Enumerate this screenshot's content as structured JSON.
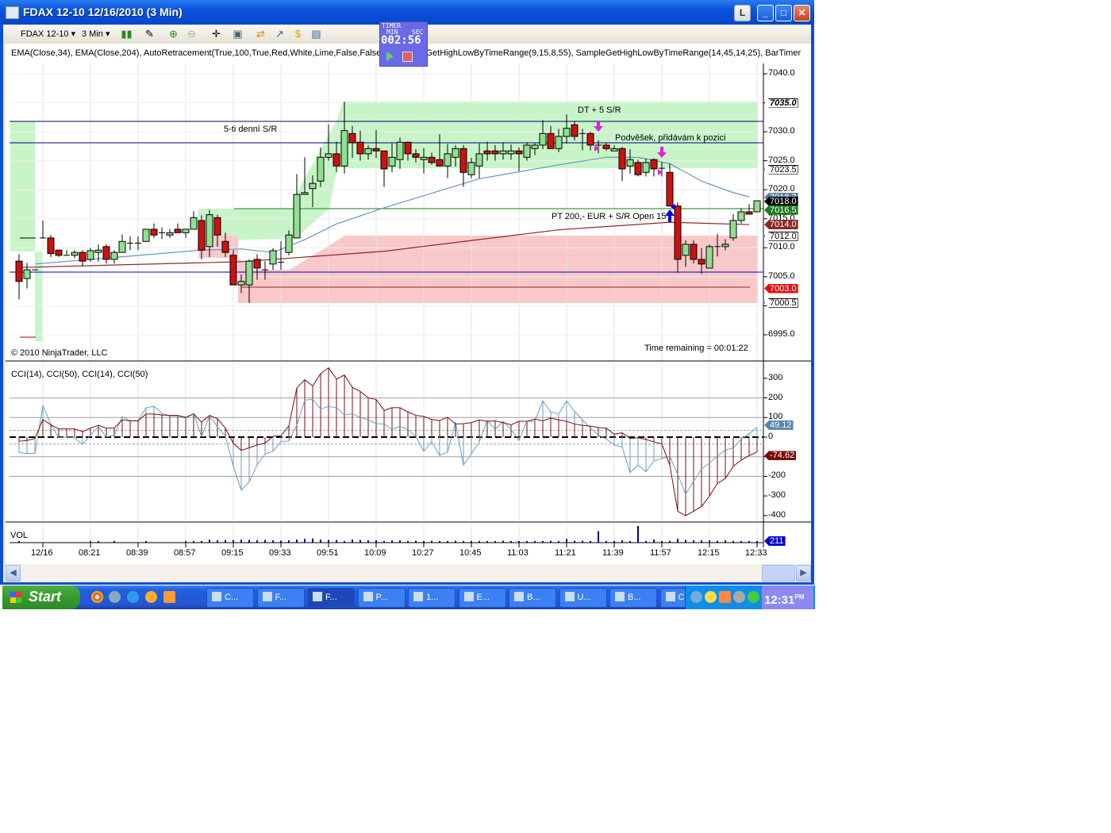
{
  "window": {
    "title": "FDAX 12-10  12/16/2010 (3 Min)",
    "btn_l": "L",
    "btn_min": "_",
    "btn_max": "□",
    "btn_close": "✕"
  },
  "toolbar": {
    "instrument": "FDAX 12-10 ▾",
    "interval": "3 Min ▾"
  },
  "timer": {
    "title": "TIMER",
    "min_label": "MIN",
    "sec_label": "SEC",
    "value": "002:56"
  },
  "indicator_label": "EMA(Close,34),  EMA(Close,204),  AutoRetracement(True,100,True,Red,White,Lime,False,False,5),  SampleGetHighLowByTimeRange(9,15,8,55),  SampleGetHighLowByTimeRange(14,45,14,25),  BarTimer",
  "annotations": {
    "sr5": "5-ti denní S/R",
    "dt": "DT + 5 S/R",
    "podvesek": "Podvěšek, přidávám k pozici",
    "pt": "PT 200,- EUR + S/R Open 15"
  },
  "copyright": "© 2010 NinjaTrader, LLC",
  "time_remaining": "Time remaining = 00:01:22",
  "cci_label": "CCI(14), CCI(50), CCI(14), CCI(50)",
  "vol_label": "VOL",
  "taskbar": {
    "start": "Start",
    "tasks": [
      "C...",
      "F...",
      "F...",
      "P...",
      "1...",
      "E...",
      "B...",
      "U...",
      "B...",
      "CS"
    ],
    "clock": "12:31",
    "clock_ampm": "PM"
  },
  "chart_data": {
    "type": "candlestick",
    "title": "FDAX 12-10 12/16/2010 (3 Min)",
    "price_axis": {
      "ylim": [
        6993,
        7042
      ],
      "ticks": [
        "7040.0",
        "7035.0",
        "7030.0",
        "7025.0",
        "7020.0",
        "7015.0",
        "7010.0",
        "7005.0",
        "7000.0",
        "6995.0"
      ]
    },
    "price_tags": [
      {
        "value": 7035.0,
        "label": "7035.0",
        "bg": "#ffffff",
        "fg": "#000000"
      },
      {
        "value": 7023.5,
        "label": "7023.5",
        "bg": "#ffffff",
        "fg": "#000000"
      },
      {
        "value": 7018.7,
        "label": "7018.7",
        "bg": "#5a7fa0",
        "fg": "#ffffff"
      },
      {
        "value": 7018.0,
        "label": "7018.0",
        "bg": "#000000",
        "fg": "#ffffff"
      },
      {
        "value": 7016.5,
        "label": "7016.5",
        "bg": "#1e7a1e",
        "fg": "#ffffff"
      },
      {
        "value": 7014.0,
        "label": "7014.0",
        "bg": "#8b2a2a",
        "fg": "#ffffff"
      },
      {
        "value": 7012.0,
        "label": "7012.0",
        "bg": "#ffffff",
        "fg": "#000000"
      },
      {
        "value": 7003.0,
        "label": "7003.0",
        "bg": "#e01010",
        "fg": "#ffffff"
      },
      {
        "value": 7000.5,
        "label": "7000.5",
        "bg": "#ffffff",
        "fg": "#000000"
      }
    ],
    "x_ticks": [
      {
        "label": "12/16",
        "bar": 3
      },
      {
        "label": "08:21",
        "bar": 9
      },
      {
        "label": "08:39",
        "bar": 15
      },
      {
        "label": "08:57",
        "bar": 21
      },
      {
        "label": "09:15",
        "bar": 27
      },
      {
        "label": "09:33",
        "bar": 33
      },
      {
        "label": "09:51",
        "bar": 39
      },
      {
        "label": "10:09",
        "bar": 45
      },
      {
        "label": "10:27",
        "bar": 51
      },
      {
        "label": "10:45",
        "bar": 57
      },
      {
        "label": "11:03",
        "bar": 63
      },
      {
        "label": "11:21",
        "bar": 69
      },
      {
        "label": "11:39",
        "bar": 75
      },
      {
        "label": "11:57",
        "bar": 81
      },
      {
        "label": "12:15",
        "bar": 87
      },
      {
        "label": "12:33",
        "bar": 93
      }
    ],
    "ohlc": [
      [
        7007.7,
        7008.9,
        7001.1,
        7004.2
      ],
      [
        7004.7,
        7007.4,
        7003.0,
        7006.2
      ],
      [
        7006.2,
        7006.3,
        7006.1,
        7006.2
      ],
      [
        7011.7,
        7014.7,
        7011.6,
        7011.7
      ],
      [
        7011.7,
        7012.2,
        7008.4,
        7009.0
      ],
      [
        7009.6,
        7009.6,
        7008.4,
        7008.7
      ],
      [
        7008.7,
        7009.6,
        7008.7,
        7008.7
      ],
      [
        7008.7,
        7009.6,
        7008.2,
        7009.2
      ],
      [
        7009.2,
        7009.6,
        7006.8,
        7007.7
      ],
      [
        7008.0,
        7010.0,
        7007.6,
        7009.5
      ],
      [
        7009.2,
        7010.6,
        7007.6,
        7009.6
      ],
      [
        7010.2,
        7010.6,
        7007.3,
        7008.0
      ],
      [
        7008.0,
        7009.6,
        7007.3,
        7009.2
      ],
      [
        7009.2,
        7012.3,
        7009.2,
        7011.1
      ],
      [
        7010.8,
        7012.0,
        7009.6,
        7010.8
      ],
      [
        7010.8,
        7012.0,
        7009.6,
        7010.8
      ],
      [
        7011.1,
        7013.2,
        7011.1,
        7013.2
      ],
      [
        7013.2,
        7014.2,
        7011.7,
        7012.2
      ],
      [
        7012.6,
        7013.5,
        7011.5,
        7012.6
      ],
      [
        7012.2,
        7013.2,
        7011.7,
        7012.6
      ],
      [
        7013.2,
        7014.2,
        7012.6,
        7012.6
      ],
      [
        7012.6,
        7013.2,
        7011.7,
        7013.2
      ],
      [
        7013.2,
        7016.3,
        7013.2,
        7015.2
      ],
      [
        7014.7,
        7015.6,
        7008.0,
        7009.6
      ],
      [
        7010.2,
        7016.5,
        7008.4,
        7015.7
      ],
      [
        7015.2,
        7015.7,
        7010.2,
        7012.2
      ],
      [
        7011.1,
        7012.6,
        7008.4,
        7009.2
      ],
      [
        7008.7,
        7009.6,
        7003.6,
        7003.6
      ],
      [
        7003.6,
        7005.4,
        7002.2,
        7004.2
      ],
      [
        7003.6,
        7008.0,
        7000.5,
        7007.7
      ],
      [
        7008.0,
        7008.9,
        7004.5,
        7006.5
      ],
      [
        7006.2,
        7007.7,
        7004.5,
        7006.2
      ],
      [
        7007.2,
        7009.9,
        7006.2,
        7009.5
      ],
      [
        7007.5,
        7011.1,
        7006.2,
        7007.5
      ],
      [
        7009.2,
        7013.0,
        7008.7,
        7012.2
      ],
      [
        7011.7,
        7022.7,
        7011.7,
        7019.2
      ],
      [
        7019.2,
        7025.6,
        7019.2,
        7019.5
      ],
      [
        7020.2,
        7022.5,
        7017.0,
        7021.1
      ],
      [
        7021.5,
        7027.3,
        7020.5,
        7025.6
      ],
      [
        7025.6,
        7031.3,
        7025.0,
        7026.2
      ],
      [
        7026.2,
        7028.3,
        7023.0,
        7024.1
      ],
      [
        7024.1,
        7035.2,
        7022.8,
        7030.2
      ],
      [
        7029.7,
        7031.0,
        7025.5,
        7028.1
      ],
      [
        7028.2,
        7030.2,
        7025.0,
        7026.2
      ],
      [
        7026.2,
        7027.7,
        7025.2,
        7027.1
      ],
      [
        7027.1,
        7030.3,
        7025.5,
        7026.7
      ],
      [
        7026.7,
        7026.7,
        7020.5,
        7023.6
      ],
      [
        7024.1,
        7028.0,
        7023.0,
        7025.6
      ],
      [
        7025.2,
        7029.0,
        7023.6,
        7028.2
      ],
      [
        7028.2,
        7028.3,
        7025.0,
        7026.2
      ],
      [
        7026.2,
        7027.0,
        7024.7,
        7025.6
      ],
      [
        7025.2,
        7027.2,
        7022.8,
        7025.6
      ],
      [
        7025.6,
        7026.4,
        7024.3,
        7024.7
      ],
      [
        7025.2,
        7029.6,
        7024.0,
        7024.1
      ],
      [
        7024.1,
        7027.9,
        7022.0,
        7026.2
      ],
      [
        7025.6,
        7027.7,
        7024.0,
        7027.1
      ],
      [
        7027.1,
        7027.7,
        7020.5,
        7023.0
      ],
      [
        7022.6,
        7025.5,
        7022.0,
        7024.7
      ],
      [
        7024.1,
        7028.0,
        7022.0,
        7026.2
      ],
      [
        7026.7,
        7028.3,
        7025.0,
        7026.2
      ],
      [
        7026.7,
        7027.7,
        7025.0,
        7026.2
      ],
      [
        7026.2,
        7028.2,
        7025.2,
        7026.7
      ],
      [
        7026.2,
        7027.8,
        7025.2,
        7026.7
      ],
      [
        7026.7,
        7027.3,
        7023.2,
        7026.2
      ],
      [
        7025.6,
        7028.2,
        7025.0,
        7027.7
      ],
      [
        7027.1,
        7028.0,
        7026.0,
        7027.7
      ],
      [
        7027.7,
        7032.0,
        7027.0,
        7029.7
      ],
      [
        7029.7,
        7031.0,
        7027.1,
        7027.1
      ],
      [
        7027.1,
        7030.5,
        7026.5,
        7029.2
      ],
      [
        7029.2,
        7033.0,
        7028.0,
        7030.6
      ],
      [
        7031.2,
        7031.8,
        7028.5,
        7029.2
      ],
      [
        7029.7,
        7030.5,
        7026.8,
        7029.7
      ],
      [
        7029.7,
        7030.0,
        7026.8,
        7027.7
      ],
      [
        7027.7,
        7028.5,
        7026.3,
        7027.7
      ],
      [
        7027.7,
        7028.1,
        7026.7,
        7027.1
      ],
      [
        7026.7,
        7027.7,
        7026.7,
        7027.1
      ],
      [
        7027.1,
        7027.4,
        7021.5,
        7023.6
      ],
      [
        7024.1,
        7027.0,
        7022.8,
        7025.2
      ],
      [
        7024.7,
        7025.2,
        7022.3,
        7022.6
      ],
      [
        7023.0,
        7025.4,
        7022.3,
        7024.7
      ],
      [
        7025.2,
        7025.4,
        7022.3,
        7023.6
      ],
      [
        7023.7,
        7024.8,
        7022.3,
        7023.7
      ],
      [
        7023.0,
        7024.5,
        7017.2,
        7017.2
      ],
      [
        7017.2,
        7017.8,
        7005.7,
        7008.0
      ],
      [
        7008.7,
        7011.3,
        7006.7,
        7010.6
      ],
      [
        7010.6,
        7011.3,
        7007.3,
        7008.0
      ],
      [
        7008.0,
        7010.0,
        7005.5,
        7007.2
      ],
      [
        7006.5,
        7010.6,
        7006.5,
        7010.2
      ],
      [
        7010.2,
        7012.4,
        7008.5,
        7010.2
      ],
      [
        7010.2,
        7011.5,
        7009.6,
        7010.6
      ],
      [
        7011.7,
        7015.8,
        7011.2,
        7014.7
      ],
      [
        7014.7,
        7016.8,
        7014.2,
        7016.2
      ],
      [
        7016.2,
        7017.5,
        7015.8,
        7015.8
      ],
      [
        7016.2,
        7018.1,
        7016.2,
        7018.1
      ]
    ],
    "ema34": {
      "name": "EMA(Close,34)",
      "color": "#6a94bc",
      "points": [
        [
          2,
          7007.2
        ],
        [
          23,
          7009.6
        ],
        [
          28,
          7009.8
        ],
        [
          32,
          7009.2
        ],
        [
          36,
          7011.4
        ],
        [
          40,
          7014.1
        ],
        [
          46,
          7016.9
        ],
        [
          58,
          7021.9
        ],
        [
          68,
          7024.3
        ],
        [
          74,
          7025.6
        ],
        [
          78,
          7025.6
        ],
        [
          82,
          7024.5
        ],
        [
          86,
          7021.5
        ],
        [
          90,
          7019.5
        ],
        [
          92,
          7018.8
        ]
      ]
    },
    "ema204": {
      "name": "EMA(Close,204)",
      "color": "#8b2a2a",
      "points": [
        [
          0,
          7006.6
        ],
        [
          28,
          7007.6
        ],
        [
          46,
          7009.4
        ],
        [
          68,
          7013.1
        ],
        [
          82,
          7014.4
        ],
        [
          92,
          7014.0
        ]
      ]
    },
    "levels": {
      "sr_high_1": 7031.4,
      "sr_high_2": 7027.6,
      "sr_low": 7005.4,
      "pt_line": 7016.75,
      "red_line": 7003.2
    },
    "cci": {
      "axis_ticks": [
        "300",
        "200",
        "100",
        "0",
        "-100",
        "-200",
        "-300",
        "-400"
      ],
      "ylim": [
        -420,
        330
      ],
      "cci14": {
        "name": "CCI(14)",
        "color": "#6a9ec0",
        "last_label": "49.12",
        "values": [
          -79,
          -83,
          -83,
          161,
          67,
          -3,
          1,
          -3,
          -38,
          11,
          53,
          1,
          11,
          104,
          83,
          85,
          150,
          157,
          122,
          108,
          108,
          97,
          119,
          4,
          108,
          53,
          4,
          -149,
          -271,
          -229,
          -142,
          -86,
          -72,
          -24,
          -19,
          60,
          188,
          194,
          143,
          157,
          150,
          113,
          119,
          101,
          88,
          69,
          67,
          39,
          56,
          39,
          4,
          -72,
          -24,
          -93,
          -76,
          76,
          -142,
          -86,
          -24,
          85,
          39,
          81,
          39,
          -17,
          81,
          81,
          185,
          129,
          118,
          185,
          131,
          88,
          46,
          11,
          -10,
          -40,
          -51,
          -181,
          -142,
          -176,
          -121,
          -110,
          -97,
          -190,
          -292,
          -225,
          -163,
          -132,
          -97,
          -65,
          -56,
          -10,
          18,
          49
        ]
      },
      "cci50": {
        "name": "CCI(50)",
        "color": "#7a0c0c",
        "last_label": "-74.62",
        "values": [
          -21,
          -17,
          -7,
          90,
          63,
          42,
          42,
          42,
          28,
          46,
          60,
          46,
          46,
          88,
          83,
          83,
          118,
          118,
          113,
          111,
          111,
          101,
          119,
          76,
          111,
          94,
          46,
          -31,
          -68,
          -54,
          -40,
          -31,
          4,
          7,
          57,
          251,
          293,
          261,
          324,
          354,
          296,
          317,
          254,
          233,
          201,
          192,
          136,
          150,
          150,
          129,
          111,
          106,
          90,
          85,
          101,
          67,
          69,
          74,
          88,
          81,
          83,
          74,
          63,
          81,
          81,
          92,
          83,
          97,
          88,
          81,
          67,
          60,
          56,
          49,
          46,
          15,
          22,
          -7,
          -3,
          -12,
          -24,
          -35,
          -142,
          -378,
          -401,
          -378,
          -354,
          -301,
          -236,
          -211,
          -149,
          -117,
          -95,
          -75
        ]
      }
    },
    "volume": {
      "last_label": "211",
      "color": "#00008b",
      "values": [
        60,
        0,
        0,
        0,
        0,
        0,
        0,
        0,
        0,
        60,
        60,
        0,
        60,
        0,
        0,
        0,
        60,
        0,
        0,
        0,
        0,
        60,
        100,
        200,
        400,
        300,
        350,
        350,
        400,
        350,
        300,
        350,
        300,
        250,
        300,
        400,
        500,
        550,
        400,
        350,
        350,
        200,
        400,
        350,
        300,
        300,
        200,
        300,
        300,
        200,
        250,
        200,
        250,
        200,
        200,
        250,
        200,
        200,
        200,
        200,
        200,
        250,
        200,
        200,
        200,
        200,
        200,
        250,
        200,
        500,
        250,
        250,
        200,
        1500,
        200,
        200,
        300,
        200,
        2200,
        200,
        400,
        200,
        250,
        500,
        350,
        300,
        300,
        300,
        250,
        300,
        200,
        200,
        200,
        211
      ]
    }
  }
}
